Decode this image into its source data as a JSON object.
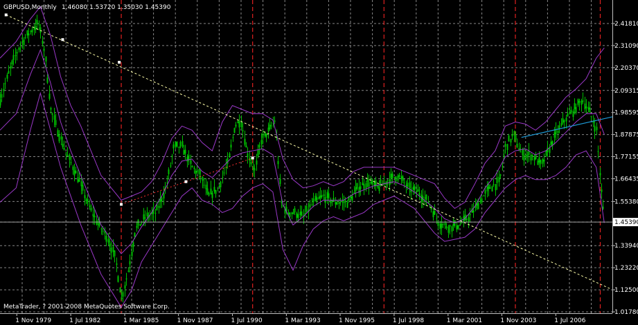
{
  "header": {
    "symbol": "GBPUSD,Monthly",
    "ohlc": "1.46080 1.53720 1.35030 1.45390"
  },
  "copyright": "MetaTrader, ? 2001-2008 MetaQuotes Software Corp.",
  "current_price_label": "1.45390",
  "colors": {
    "background": "#000000",
    "grid": "#c0c0c0",
    "candle": "#00c000",
    "bollinger": "#9a38c8",
    "trendline_main": "#ffffaa",
    "trendline_blue": "#1e9bd8",
    "period_separator": "#e02020",
    "fib_dotted": "#ff3030",
    "price_line": "#a0a0a0"
  },
  "chart_data": {
    "type": "candlestick",
    "symbol": "GBPUSD",
    "timeframe": "Monthly",
    "y_tick_labels": [
      "2.41810",
      "2.31090",
      "2.20370",
      "2.09315",
      "1.98595",
      "1.87875",
      "1.77155",
      "1.66435",
      "1.55380",
      "1.45390",
      "1.33940",
      "1.23220",
      "1.12500",
      "1.01780"
    ],
    "y_ticks": [
      2.4181,
      2.3109,
      2.2037,
      2.09315,
      1.98595,
      1.87875,
      1.77155,
      1.66435,
      1.5538,
      1.4539,
      1.3394,
      1.2322,
      1.125,
      1.0178
    ],
    "ylim": [
      1.0178,
      2.4181
    ],
    "x_tick_labels": [
      "1 Nov 1979",
      "1 Jul 1982",
      "1 Mar 1985",
      "1 Nov 1987",
      "1 Jul 1990",
      "1 Mar 1993",
      "1 Nov 1995",
      "1 Jul 1998",
      "1 Mar 2001",
      "1 Nov 2003",
      "1 Jul 2006"
    ],
    "x_ticks": [
      1979.83,
      1982.5,
      1985.17,
      1987.83,
      1990.5,
      1993.17,
      1995.83,
      1998.5,
      2001.17,
      2003.83,
      2006.5
    ],
    "xlim": [
      1979.0,
      2009.3
    ],
    "period_separators": [
      1985.0,
      1991.5,
      1998.0,
      2004.5,
      2008.7
    ],
    "price_path": [
      [
        1979.0,
        2.05
      ],
      [
        1979.5,
        2.2
      ],
      [
        1980.0,
        2.32
      ],
      [
        1980.5,
        2.38
      ],
      [
        1980.9,
        2.42
      ],
      [
        1981.2,
        2.28
      ],
      [
        1981.5,
        2.0
      ],
      [
        1981.9,
        1.88
      ],
      [
        1982.3,
        1.78
      ],
      [
        1982.8,
        1.68
      ],
      [
        1983.3,
        1.55
      ],
      [
        1983.8,
        1.45
      ],
      [
        1984.3,
        1.38
      ],
      [
        1984.7,
        1.28
      ],
      [
        1985.0,
        1.08
      ],
      [
        1985.3,
        1.2
      ],
      [
        1985.7,
        1.42
      ],
      [
        1986.2,
        1.48
      ],
      [
        1986.7,
        1.5
      ],
      [
        1987.2,
        1.62
      ],
      [
        1987.6,
        1.82
      ],
      [
        1988.0,
        1.82
      ],
      [
        1988.5,
        1.72
      ],
      [
        1988.9,
        1.68
      ],
      [
        1989.3,
        1.58
      ],
      [
        1989.8,
        1.62
      ],
      [
        1990.3,
        1.75
      ],
      [
        1990.6,
        1.92
      ],
      [
        1990.9,
        1.95
      ],
      [
        1991.2,
        1.8
      ],
      [
        1991.6,
        1.7
      ],
      [
        1991.9,
        1.85
      ],
      [
        1992.3,
        1.9
      ],
      [
        1992.6,
        1.95
      ],
      [
        1992.9,
        1.55
      ],
      [
        1993.2,
        1.5
      ],
      [
        1993.6,
        1.5
      ],
      [
        1994.0,
        1.48
      ],
      [
        1994.5,
        1.55
      ],
      [
        1995.0,
        1.58
      ],
      [
        1995.6,
        1.55
      ],
      [
        1996.2,
        1.55
      ],
      [
        1996.7,
        1.62
      ],
      [
        1997.2,
        1.65
      ],
      [
        1997.7,
        1.62
      ],
      [
        1998.2,
        1.66
      ],
      [
        1998.7,
        1.68
      ],
      [
        1999.2,
        1.62
      ],
      [
        1999.7,
        1.6
      ],
      [
        2000.2,
        1.55
      ],
      [
        2000.7,
        1.45
      ],
      [
        2001.2,
        1.43
      ],
      [
        2001.7,
        1.44
      ],
      [
        2002.2,
        1.48
      ],
      [
        2002.7,
        1.55
      ],
      [
        2003.2,
        1.62
      ],
      [
        2003.7,
        1.65
      ],
      [
        2004.0,
        1.82
      ],
      [
        2004.4,
        1.88
      ],
      [
        2004.8,
        1.78
      ],
      [
        2005.3,
        1.78
      ],
      [
        2005.8,
        1.73
      ],
      [
        2006.2,
        1.82
      ],
      [
        2006.6,
        1.9
      ],
      [
        2007.0,
        1.96
      ],
      [
        2007.4,
        2.0
      ],
      [
        2007.8,
        2.05
      ],
      [
        2008.2,
        1.98
      ],
      [
        2008.5,
        1.9
      ],
      [
        2008.7,
        1.65
      ],
      [
        2008.9,
        1.45
      ]
    ],
    "bollinger_upper": [
      [
        1979.0,
        2.25
      ],
      [
        1979.8,
        2.33
      ],
      [
        1980.5,
        2.44
      ],
      [
        1981.0,
        2.5
      ],
      [
        1981.5,
        2.36
      ],
      [
        1982.0,
        2.16
      ],
      [
        1982.5,
        2.02
      ],
      [
        1983.0,
        1.92
      ],
      [
        1983.5,
        1.8
      ],
      [
        1984.0,
        1.68
      ],
      [
        1984.5,
        1.62
      ],
      [
        1985.0,
        1.56
      ],
      [
        1985.5,
        1.58
      ],
      [
        1986.0,
        1.6
      ],
      [
        1986.5,
        1.65
      ],
      [
        1987.0,
        1.74
      ],
      [
        1987.5,
        1.86
      ],
      [
        1988.0,
        1.92
      ],
      [
        1988.5,
        1.9
      ],
      [
        1989.0,
        1.84
      ],
      [
        1989.5,
        1.8
      ],
      [
        1990.0,
        1.94
      ],
      [
        1990.5,
        2.02
      ],
      [
        1991.0,
        2.0
      ],
      [
        1991.5,
        1.98
      ],
      [
        1992.0,
        1.98
      ],
      [
        1992.5,
        1.95
      ],
      [
        1993.0,
        1.76
      ],
      [
        1993.5,
        1.66
      ],
      [
        1994.0,
        1.62
      ],
      [
        1994.5,
        1.63
      ],
      [
        1995.0,
        1.65
      ],
      [
        1995.5,
        1.63
      ],
      [
        1996.0,
        1.65
      ],
      [
        1996.5,
        1.7
      ],
      [
        1997.0,
        1.72
      ],
      [
        1997.5,
        1.72
      ],
      [
        1998.0,
        1.72
      ],
      [
        1998.5,
        1.72
      ],
      [
        1999.0,
        1.7
      ],
      [
        1999.5,
        1.68
      ],
      [
        2000.0,
        1.66
      ],
      [
        2000.5,
        1.64
      ],
      [
        2001.0,
        1.57
      ],
      [
        2001.5,
        1.52
      ],
      [
        2002.0,
        1.55
      ],
      [
        2002.5,
        1.64
      ],
      [
        2003.0,
        1.74
      ],
      [
        2003.5,
        1.8
      ],
      [
        2004.0,
        1.92
      ],
      [
        2004.5,
        1.94
      ],
      [
        2005.0,
        1.93
      ],
      [
        2005.5,
        1.9
      ],
      [
        2006.0,
        1.94
      ],
      [
        2006.5,
        2.0
      ],
      [
        2007.0,
        2.06
      ],
      [
        2007.5,
        2.1
      ],
      [
        2008.0,
        2.15
      ],
      [
        2008.5,
        2.25
      ],
      [
        2008.9,
        2.3
      ]
    ],
    "bollinger_lower": [
      [
        1979.0,
        1.55
      ],
      [
        1979.8,
        1.62
      ],
      [
        1980.5,
        1.9
      ],
      [
        1981.0,
        2.08
      ],
      [
        1981.5,
        1.9
      ],
      [
        1982.0,
        1.72
      ],
      [
        1982.5,
        1.58
      ],
      [
        1983.0,
        1.44
      ],
      [
        1983.5,
        1.32
      ],
      [
        1984.0,
        1.2
      ],
      [
        1984.5,
        1.12
      ],
      [
        1985.0,
        1.04
      ],
      [
        1985.5,
        1.12
      ],
      [
        1986.0,
        1.26
      ],
      [
        1986.5,
        1.34
      ],
      [
        1987.0,
        1.42
      ],
      [
        1987.5,
        1.5
      ],
      [
        1988.0,
        1.58
      ],
      [
        1988.5,
        1.62
      ],
      [
        1989.0,
        1.56
      ],
      [
        1989.5,
        1.54
      ],
      [
        1990.0,
        1.5
      ],
      [
        1990.5,
        1.52
      ],
      [
        1991.0,
        1.58
      ],
      [
        1991.5,
        1.62
      ],
      [
        1992.0,
        1.64
      ],
      [
        1992.5,
        1.6
      ],
      [
        1993.0,
        1.32
      ],
      [
        1993.5,
        1.22
      ],
      [
        1994.0,
        1.34
      ],
      [
        1994.5,
        1.42
      ],
      [
        1995.0,
        1.46
      ],
      [
        1995.5,
        1.48
      ],
      [
        1996.0,
        1.46
      ],
      [
        1996.5,
        1.48
      ],
      [
        1997.0,
        1.5
      ],
      [
        1997.5,
        1.54
      ],
      [
        1998.0,
        1.56
      ],
      [
        1998.5,
        1.58
      ],
      [
        1999.0,
        1.55
      ],
      [
        1999.5,
        1.52
      ],
      [
        2000.0,
        1.46
      ],
      [
        2000.5,
        1.4
      ],
      [
        2001.0,
        1.36
      ],
      [
        2001.5,
        1.37
      ],
      [
        2002.0,
        1.38
      ],
      [
        2002.5,
        1.42
      ],
      [
        2003.0,
        1.5
      ],
      [
        2003.5,
        1.56
      ],
      [
        2004.0,
        1.62
      ],
      [
        2004.5,
        1.66
      ],
      [
        2005.0,
        1.68
      ],
      [
        2005.5,
        1.66
      ],
      [
        2006.0,
        1.66
      ],
      [
        2006.5,
        1.68
      ],
      [
        2007.0,
        1.72
      ],
      [
        2007.5,
        1.78
      ],
      [
        2008.0,
        1.8
      ],
      [
        2008.5,
        1.72
      ],
      [
        2008.9,
        1.45
      ]
    ],
    "bollinger_middle": [
      [
        1979.0,
        1.9
      ],
      [
        1979.8,
        1.98
      ],
      [
        1980.5,
        2.17
      ],
      [
        1981.0,
        2.29
      ],
      [
        1981.5,
        2.13
      ],
      [
        1982.0,
        1.94
      ],
      [
        1982.5,
        1.8
      ],
      [
        1983.0,
        1.68
      ],
      [
        1983.5,
        1.56
      ],
      [
        1984.0,
        1.44
      ],
      [
        1984.5,
        1.37
      ],
      [
        1985.0,
        1.3
      ],
      [
        1985.5,
        1.35
      ],
      [
        1986.0,
        1.43
      ],
      [
        1986.5,
        1.5
      ],
      [
        1987.0,
        1.58
      ],
      [
        1987.5,
        1.68
      ],
      [
        1988.0,
        1.75
      ],
      [
        1988.5,
        1.76
      ],
      [
        1989.0,
        1.7
      ],
      [
        1989.5,
        1.67
      ],
      [
        1990.0,
        1.72
      ],
      [
        1990.5,
        1.77
      ],
      [
        1991.0,
        1.79
      ],
      [
        1991.5,
        1.8
      ],
      [
        1992.0,
        1.81
      ],
      [
        1992.5,
        1.78
      ],
      [
        1993.0,
        1.54
      ],
      [
        1993.5,
        1.44
      ],
      [
        1994.0,
        1.48
      ],
      [
        1994.5,
        1.53
      ],
      [
        1995.0,
        1.56
      ],
      [
        1995.5,
        1.56
      ],
      [
        1996.0,
        1.56
      ],
      [
        1996.5,
        1.59
      ],
      [
        1997.0,
        1.61
      ],
      [
        1997.5,
        1.63
      ],
      [
        1998.0,
        1.64
      ],
      [
        1998.5,
        1.65
      ],
      [
        1999.0,
        1.63
      ],
      [
        1999.5,
        1.6
      ],
      [
        2000.0,
        1.56
      ],
      [
        2000.5,
        1.52
      ],
      [
        2001.0,
        1.47
      ],
      [
        2001.5,
        1.45
      ],
      [
        2002.0,
        1.47
      ],
      [
        2002.5,
        1.53
      ],
      [
        2003.0,
        1.62
      ],
      [
        2003.5,
        1.68
      ],
      [
        2004.0,
        1.77
      ],
      [
        2004.5,
        1.8
      ],
      [
        2005.0,
        1.81
      ],
      [
        2005.5,
        1.78
      ],
      [
        2006.0,
        1.8
      ],
      [
        2006.5,
        1.84
      ],
      [
        2007.0,
        1.89
      ],
      [
        2007.5,
        1.94
      ],
      [
        2008.0,
        1.98
      ],
      [
        2008.5,
        1.98
      ],
      [
        2008.9,
        1.88
      ]
    ],
    "trendline_main": [
      [
        1979.3,
        2.46
      ],
      [
        2009.2,
        1.13
      ]
    ],
    "trendline_main_markers": [
      [
        1979.3,
        2.46
      ],
      [
        1982.1,
        2.34
      ],
      [
        1984.9,
        2.23
      ]
    ],
    "trendline_blue": [
      [
        2004.8,
        1.865
      ],
      [
        2009.3,
        1.965
      ]
    ],
    "fib_dotted": [
      [
        1985.0,
        1.54
      ],
      [
        1988.2,
        1.65
      ],
      [
        1991.5,
        1.765
      ]
    ],
    "fib_dotted_markers": [
      [
        1985.0,
        1.54
      ],
      [
        1988.2,
        1.65
      ],
      [
        1991.5,
        1.765
      ]
    ],
    "current_price": 1.4539
  }
}
